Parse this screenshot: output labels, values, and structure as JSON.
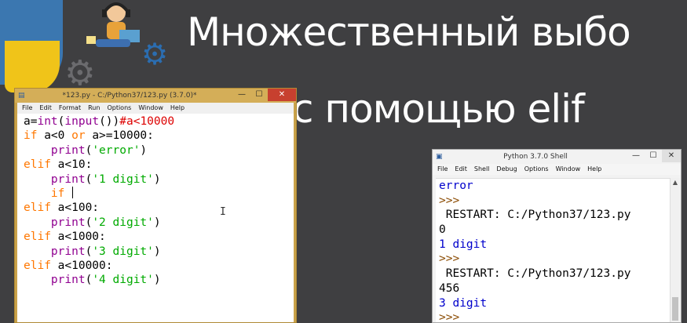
{
  "slide": {
    "title_line1": "Множественный выбо",
    "title_line2": "с помощью elif"
  },
  "editor": {
    "window_title": "*123.py - C:/Python37/123.py (3.7.0)*",
    "app_icon": "python-file-icon",
    "controls": {
      "minimize": "—",
      "maximize": "☐",
      "close": "✕"
    },
    "menu": [
      "File",
      "Edit",
      "Format",
      "Run",
      "Options",
      "Window",
      "Help"
    ],
    "code_lines": [
      [
        {
          "t": "a=",
          "c": ""
        },
        {
          "t": "int",
          "c": "bi"
        },
        {
          "t": "(",
          "c": ""
        },
        {
          "t": "input",
          "c": "bi"
        },
        {
          "t": "())",
          "c": ""
        },
        {
          "t": "#a<10000",
          "c": "cm"
        }
      ],
      [
        {
          "t": "if",
          "c": "kw"
        },
        {
          "t": " a<0 ",
          "c": ""
        },
        {
          "t": "or",
          "c": "kw"
        },
        {
          "t": " a>=10000:",
          "c": ""
        }
      ],
      [
        {
          "t": "    ",
          "c": ""
        },
        {
          "t": "print",
          "c": "bi"
        },
        {
          "t": "(",
          "c": ""
        },
        {
          "t": "'error'",
          "c": "str"
        },
        {
          "t": ")",
          "c": ""
        }
      ],
      [
        {
          "t": "elif",
          "c": "kw"
        },
        {
          "t": " a<10:",
          "c": ""
        }
      ],
      [
        {
          "t": "    ",
          "c": ""
        },
        {
          "t": "print",
          "c": "bi"
        },
        {
          "t": "(",
          "c": ""
        },
        {
          "t": "'1 digit'",
          "c": "str"
        },
        {
          "t": ")",
          "c": ""
        }
      ],
      [
        {
          "t": "    ",
          "c": ""
        },
        {
          "t": "if",
          "c": "kw"
        },
        {
          "t": " ",
          "c": ""
        }
      ],
      [
        {
          "t": "elif",
          "c": "kw"
        },
        {
          "t": " a<100:",
          "c": ""
        }
      ],
      [
        {
          "t": "    ",
          "c": ""
        },
        {
          "t": "print",
          "c": "bi"
        },
        {
          "t": "(",
          "c": ""
        },
        {
          "t": "'2 digit'",
          "c": "str"
        },
        {
          "t": ")",
          "c": ""
        }
      ],
      [
        {
          "t": "elif",
          "c": "kw"
        },
        {
          "t": " a<1000:",
          "c": ""
        }
      ],
      [
        {
          "t": "    ",
          "c": ""
        },
        {
          "t": "print",
          "c": "bi"
        },
        {
          "t": "(",
          "c": ""
        },
        {
          "t": "'3 digit'",
          "c": "str"
        },
        {
          "t": ")",
          "c": ""
        }
      ],
      [
        {
          "t": "elif",
          "c": "kw"
        },
        {
          "t": " a<10000:",
          "c": ""
        }
      ],
      [
        {
          "t": "    ",
          "c": ""
        },
        {
          "t": "print",
          "c": "bi"
        },
        {
          "t": "(",
          "c": ""
        },
        {
          "t": "'4 digit'",
          "c": "str"
        },
        {
          "t": ")",
          "c": ""
        }
      ]
    ],
    "caret_line": 5
  },
  "shell": {
    "window_title": "Python 3.7.0 Shell",
    "app_icon": "python-shell-icon",
    "controls": {
      "minimize": "—",
      "maximize": "☐",
      "close": "✕"
    },
    "menu": [
      "File",
      "Edit",
      "Shell",
      "Debug",
      "Options",
      "Window",
      "Help"
    ],
    "output_lines": [
      [
        {
          "t": "error",
          "c": "out-blue"
        }
      ],
      [
        {
          "t": ">>>",
          "c": "prompt"
        }
      ],
      [
        {
          "t": " RESTART: C:/Python37/123.py",
          "c": ""
        }
      ],
      [
        {
          "t": "0",
          "c": ""
        }
      ],
      [
        {
          "t": "1 digit",
          "c": "out-blue"
        }
      ],
      [
        {
          "t": ">>>",
          "c": "prompt"
        }
      ],
      [
        {
          "t": " RESTART: C:/Python37/123.py",
          "c": ""
        }
      ],
      [
        {
          "t": "456",
          "c": ""
        }
      ],
      [
        {
          "t": "3 digit",
          "c": "out-blue"
        }
      ],
      [
        {
          "t": ">>>",
          "c": "prompt"
        }
      ]
    ]
  },
  "colors": {
    "background": "#3f3f41",
    "keyword": "#ff7700",
    "builtin": "#900090",
    "string": "#00aa00",
    "comment": "#dd0000",
    "output": "#0000cc"
  }
}
